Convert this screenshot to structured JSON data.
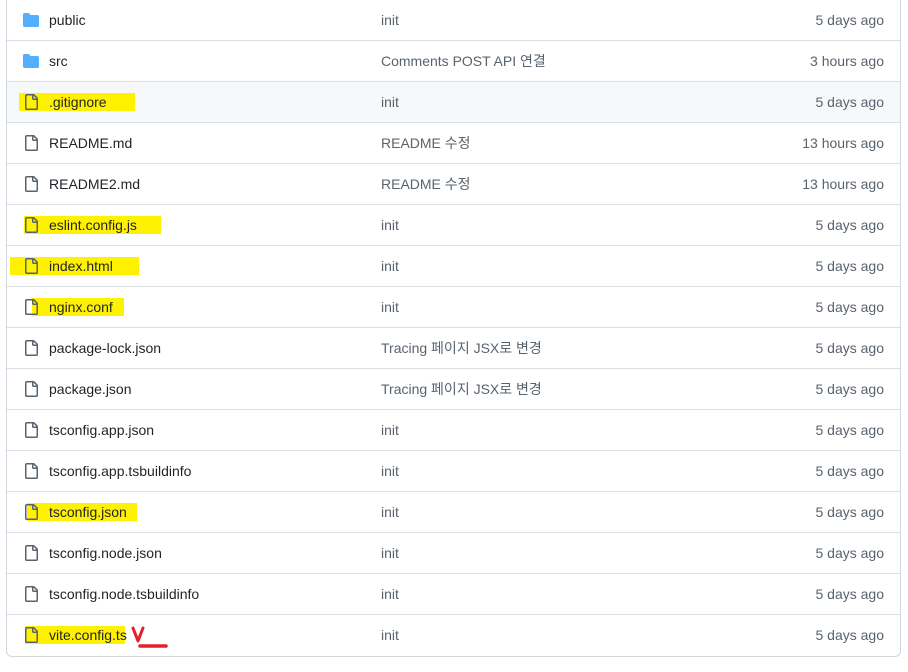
{
  "colors": {
    "folder": "#54aeff",
    "file_icon": "#59636e",
    "highlight": "#fff200",
    "annotation": "#e5202a"
  },
  "rows": [
    {
      "name": "public",
      "type": "folder",
      "commit": "init",
      "date": "5 days ago",
      "highlighted": false
    },
    {
      "name": "src",
      "type": "folder",
      "commit": "Comments POST API 연결",
      "date": "3 hours ago",
      "highlighted": false
    },
    {
      "name": ".gitignore",
      "type": "file",
      "commit": "init",
      "date": "5 days ago",
      "highlighted": true
    },
    {
      "name": "README.md",
      "type": "file",
      "commit": "README 수정",
      "date": "13 hours ago",
      "highlighted": false
    },
    {
      "name": "README2.md",
      "type": "file",
      "commit": "README 수정",
      "date": "13 hours ago",
      "highlighted": false
    },
    {
      "name": "eslint.config.js",
      "type": "file",
      "commit": "init",
      "date": "5 days ago",
      "highlighted": true
    },
    {
      "name": "index.html",
      "type": "file",
      "commit": "init",
      "date": "5 days ago",
      "highlighted": true
    },
    {
      "name": "nginx.conf",
      "type": "file",
      "commit": "init",
      "date": "5 days ago",
      "highlighted": true
    },
    {
      "name": "package-lock.json",
      "type": "file",
      "commit": "Tracing 페이지 JSX로 변경",
      "date": "5 days ago",
      "highlighted": false
    },
    {
      "name": "package.json",
      "type": "file",
      "commit": "Tracing 페이지 JSX로 변경",
      "date": "5 days ago",
      "highlighted": false
    },
    {
      "name": "tsconfig.app.json",
      "type": "file",
      "commit": "init",
      "date": "5 days ago",
      "highlighted": false
    },
    {
      "name": "tsconfig.app.tsbuildinfo",
      "type": "file",
      "commit": "init",
      "date": "5 days ago",
      "highlighted": false
    },
    {
      "name": "tsconfig.json",
      "type": "file",
      "commit": "init",
      "date": "5 days ago",
      "highlighted": true
    },
    {
      "name": "tsconfig.node.json",
      "type": "file",
      "commit": "init",
      "date": "5 days ago",
      "highlighted": false
    },
    {
      "name": "tsconfig.node.tsbuildinfo",
      "type": "file",
      "commit": "init",
      "date": "5 days ago",
      "highlighted": false
    },
    {
      "name": "vite.config.ts",
      "type": "file",
      "commit": "init",
      "date": "5 days ago",
      "highlighted": true
    }
  ]
}
